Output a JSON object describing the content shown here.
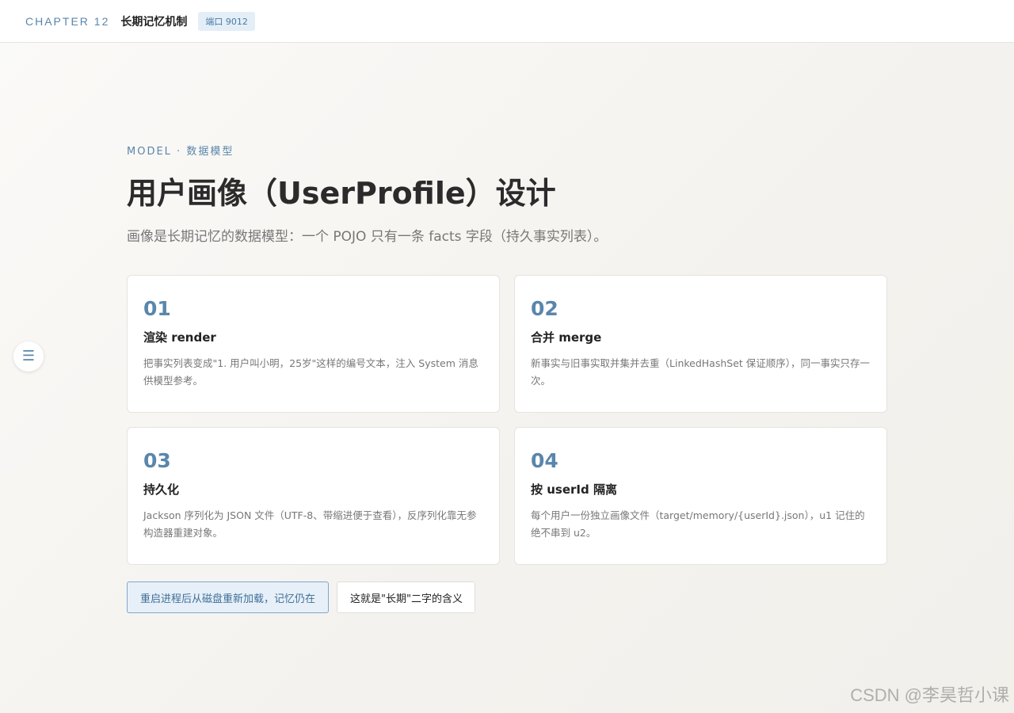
{
  "topbar": {
    "chapter_label": "CHAPTER 12",
    "chapter_title": "长期记忆机制",
    "port_badge": "端口 9012"
  },
  "menu": {
    "icon": "menu-icon",
    "glyph": "☰"
  },
  "section": {
    "eyebrow": "MODEL · 数据模型",
    "title": "用户画像（UserProfile）设计",
    "description": "画像是长期记忆的数据模型：一个 POJO 只有一条 facts 字段（持久事实列表）。"
  },
  "cards": [
    {
      "num": "01",
      "title": "渲染 render",
      "desc": "把事实列表变成\"1. 用户叫小明，25岁\"这样的编号文本，注入 System 消息供模型参考。"
    },
    {
      "num": "02",
      "title": "合并 merge",
      "desc": "新事实与旧事实取并集并去重（LinkedHashSet 保证顺序），同一事实只存一次。"
    },
    {
      "num": "03",
      "title": "持久化",
      "desc": "Jackson 序列化为 JSON 文件（UTF-8、带缩进便于查看），反序列化靠无参构造器重建对象。"
    },
    {
      "num": "04",
      "title": "按 userId 隔离",
      "desc": "每个用户一份独立画像文件（target/memory/{userId}.json），u1 记住的绝不串到 u2。"
    }
  ],
  "actions": {
    "primary_label": "重启进程后从磁盘重新加载，记忆仍在",
    "secondary_label": "这就是\"长期\"二字的含义"
  },
  "watermark": "CSDN @李昊哲小课",
  "colors": {
    "accent": "#5a86ab",
    "badge_bg": "#e4eef7",
    "primary_btn_bg": "#e7f0f8",
    "primary_btn_border": "#7ea8cb"
  }
}
